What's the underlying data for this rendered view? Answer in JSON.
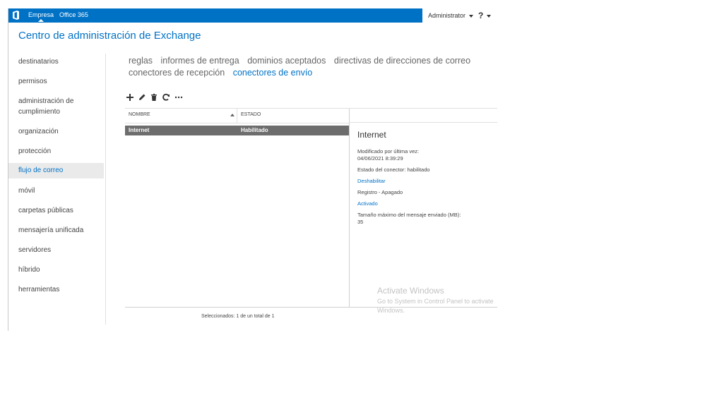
{
  "topbar": {
    "empresa": "Empresa",
    "office365": "Office 365",
    "admin_label": "Administrator",
    "help_label": "?",
    "colors": {
      "bar": "#0072c6"
    }
  },
  "app_title": "Centro de administración de Exchange",
  "nav": {
    "items": [
      {
        "label": "destinatarios"
      },
      {
        "label": "permisos"
      },
      {
        "label": "administración de cumplimiento"
      },
      {
        "label": "organización"
      },
      {
        "label": "protección"
      },
      {
        "label": "flujo de correo",
        "active": true
      },
      {
        "label": "móvil"
      },
      {
        "label": "carpetas públicas"
      },
      {
        "label": "mensajería unificada"
      },
      {
        "label": "servidores"
      },
      {
        "label": "híbrido"
      },
      {
        "label": "herramientas"
      }
    ]
  },
  "tabs": [
    {
      "label": "reglas"
    },
    {
      "label": "informes de entrega"
    },
    {
      "label": "dominios aceptados"
    },
    {
      "label": "directivas de direcciones de correo"
    },
    {
      "label": "conectores de recepción"
    },
    {
      "label": "conectores de envío",
      "active": true
    }
  ],
  "toolbar": {
    "icons": [
      "add-icon",
      "edit-icon",
      "delete-icon",
      "refresh-icon",
      "more-icon"
    ]
  },
  "list": {
    "col_name": "NOMBRE",
    "col_state": "ESTADO",
    "rows": [
      {
        "name": "Internet",
        "state": "Habilitado"
      }
    ],
    "status": "Seleccionados: 1 de un total de 1"
  },
  "details": {
    "title": "Internet",
    "modified_label": "Modificado por última vez:",
    "modified_value": "04/06/2021 8:39:29",
    "state_line": "Estado del conector: habilitado",
    "disable_link": "Deshabilitar",
    "log_line": "Registro - Apagado",
    "enable_link": "Activado",
    "maxsize_label": "Tamaño máximo del mensaje enviado (MB):",
    "maxsize_value": "35"
  },
  "watermark": {
    "line1": "Activate Windows",
    "line2": "Go to System in Control Panel to activate Windows."
  }
}
